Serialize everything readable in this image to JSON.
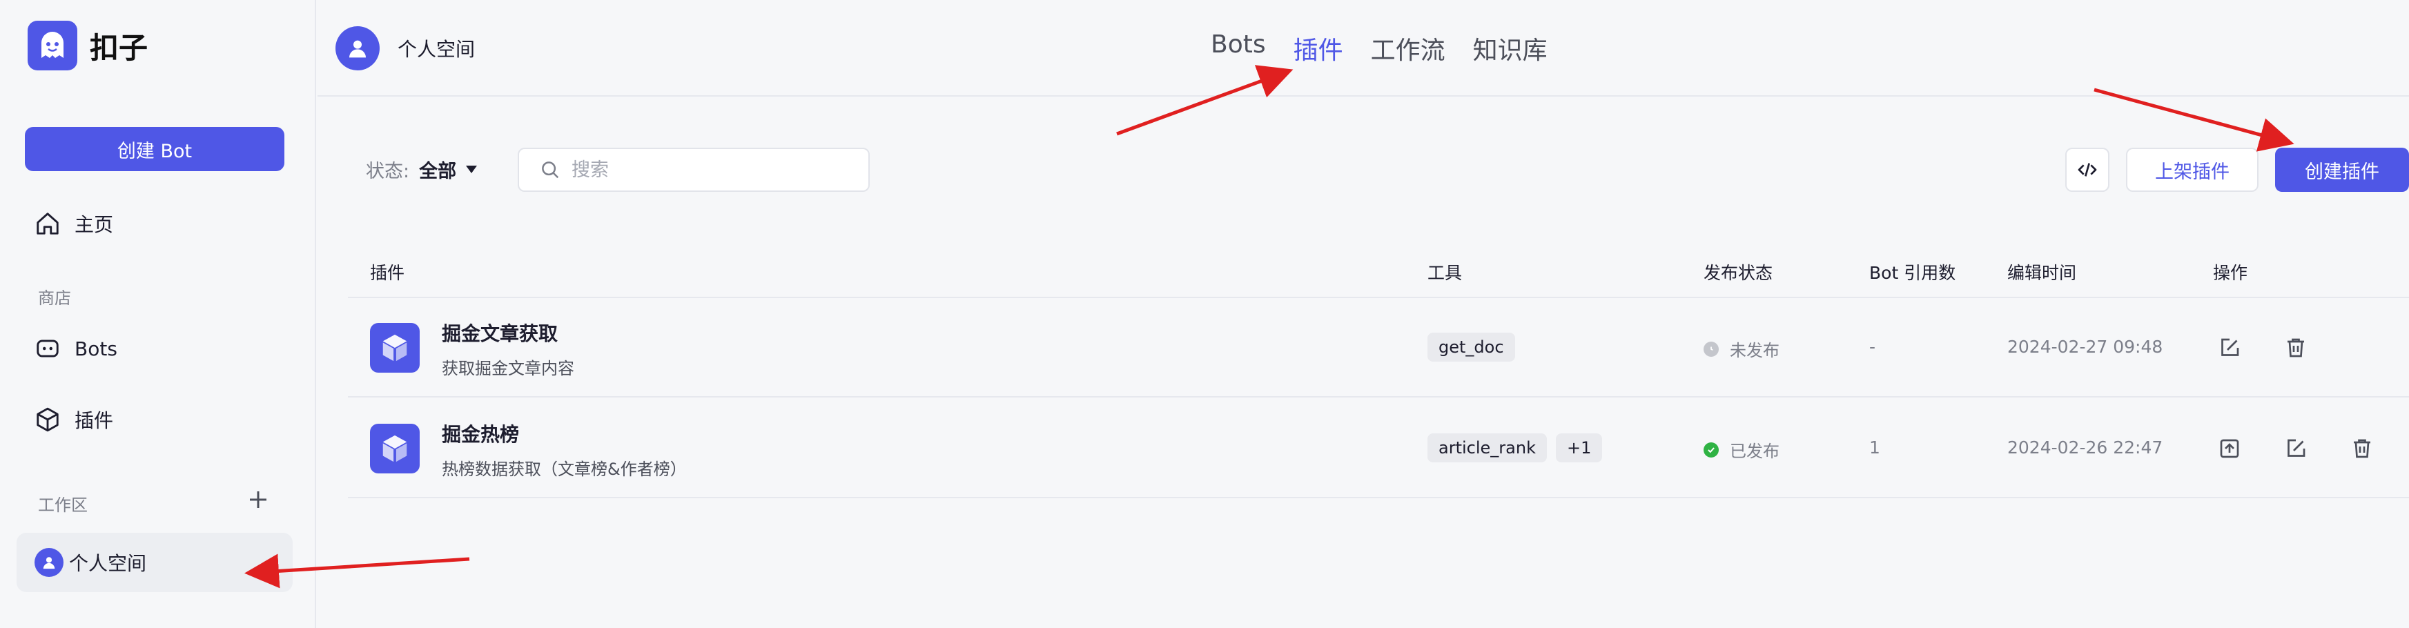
{
  "app": {
    "name": "扣子"
  },
  "sidebar": {
    "create_bot_label": "创建 Bot",
    "home_label": "主页",
    "store_section": "商店",
    "bots_label": "Bots",
    "plugins_label": "插件",
    "workspace_section": "工作区",
    "workspace_item": "个人空间"
  },
  "header": {
    "space_name": "个人空间",
    "tabs": [
      {
        "label": "Bots",
        "active": false
      },
      {
        "label": "插件",
        "active": true
      },
      {
        "label": "工作流",
        "active": false
      },
      {
        "label": "知识库",
        "active": false
      }
    ]
  },
  "toolbar": {
    "status_label": "状态:",
    "status_value": "全部",
    "search_placeholder": "搜索",
    "list_button": "上架插件",
    "create_button": "创建插件"
  },
  "table": {
    "columns": [
      "插件",
      "工具",
      "发布状态",
      "Bot 引用数",
      "编辑时间",
      "操作"
    ],
    "rows": [
      {
        "name": "掘金文章获取",
        "desc": "获取掘金文章内容",
        "tools": [
          "get_doc"
        ],
        "status": "未发布",
        "bot_refs": "-",
        "edited": "2024-02-27 09:48"
      },
      {
        "name": "掘金热榜",
        "desc": "热榜数据获取（文章榜&作者榜）",
        "tools": [
          "article_rank",
          "+1"
        ],
        "status": "已发布",
        "bot_refs": "1",
        "edited": "2024-02-26 22:47"
      }
    ]
  },
  "colors": {
    "accent": "#4f57e6",
    "published": "#2fb344",
    "unpublished": "#c4c6cc",
    "arrow": "#e02020"
  }
}
